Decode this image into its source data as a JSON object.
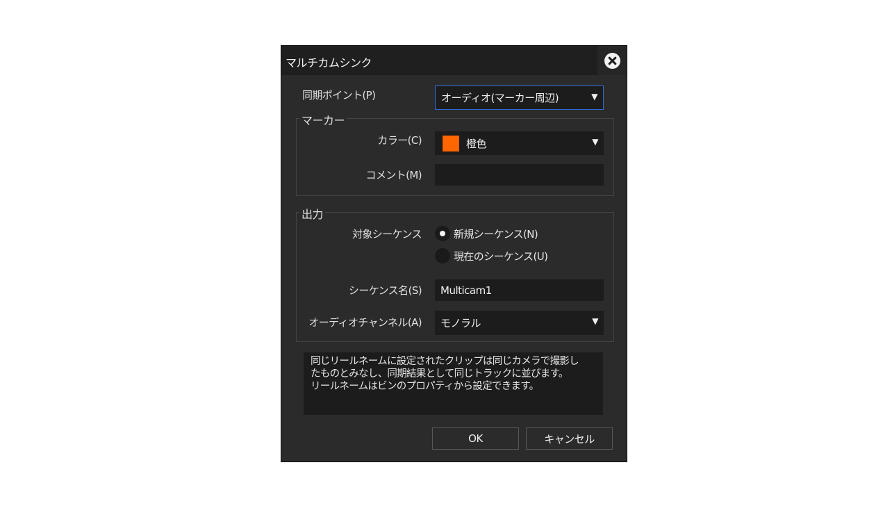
{
  "dialog": {
    "title": "マルチカムシンク",
    "close_icon": "close-icon"
  },
  "sync_point": {
    "label": "同期ポイント(P)",
    "value": "オーディオ(マーカー周辺)"
  },
  "marker": {
    "group_label": "マーカー",
    "color_label": "カラー(C)",
    "color_value": "橙色",
    "color_hex": "#ff6600",
    "comment_label": "コメント(M)",
    "comment_value": ""
  },
  "output": {
    "group_label": "出力",
    "target_label": "対象シーケンス",
    "radio_new": "新規シーケンス(N)",
    "radio_current": "現在のシーケンス(U)",
    "selected": "new",
    "sequence_name_label": "シーケンス名(S)",
    "sequence_name_value": "Multicam1",
    "audio_channel_label": "オーディオチャンネル(A)",
    "audio_channel_value": "モノラル"
  },
  "info": {
    "line1": "同じリールネームに設定されたクリップは同じカメラで撮影し",
    "line2": "たものとみなし、同期結果として同じトラックに並びます。",
    "line3": "リールネームはビンのプロパティから設定できます。"
  },
  "buttons": {
    "ok": "OK",
    "cancel": "キャンセル"
  },
  "dropdown_arrow": "▼"
}
